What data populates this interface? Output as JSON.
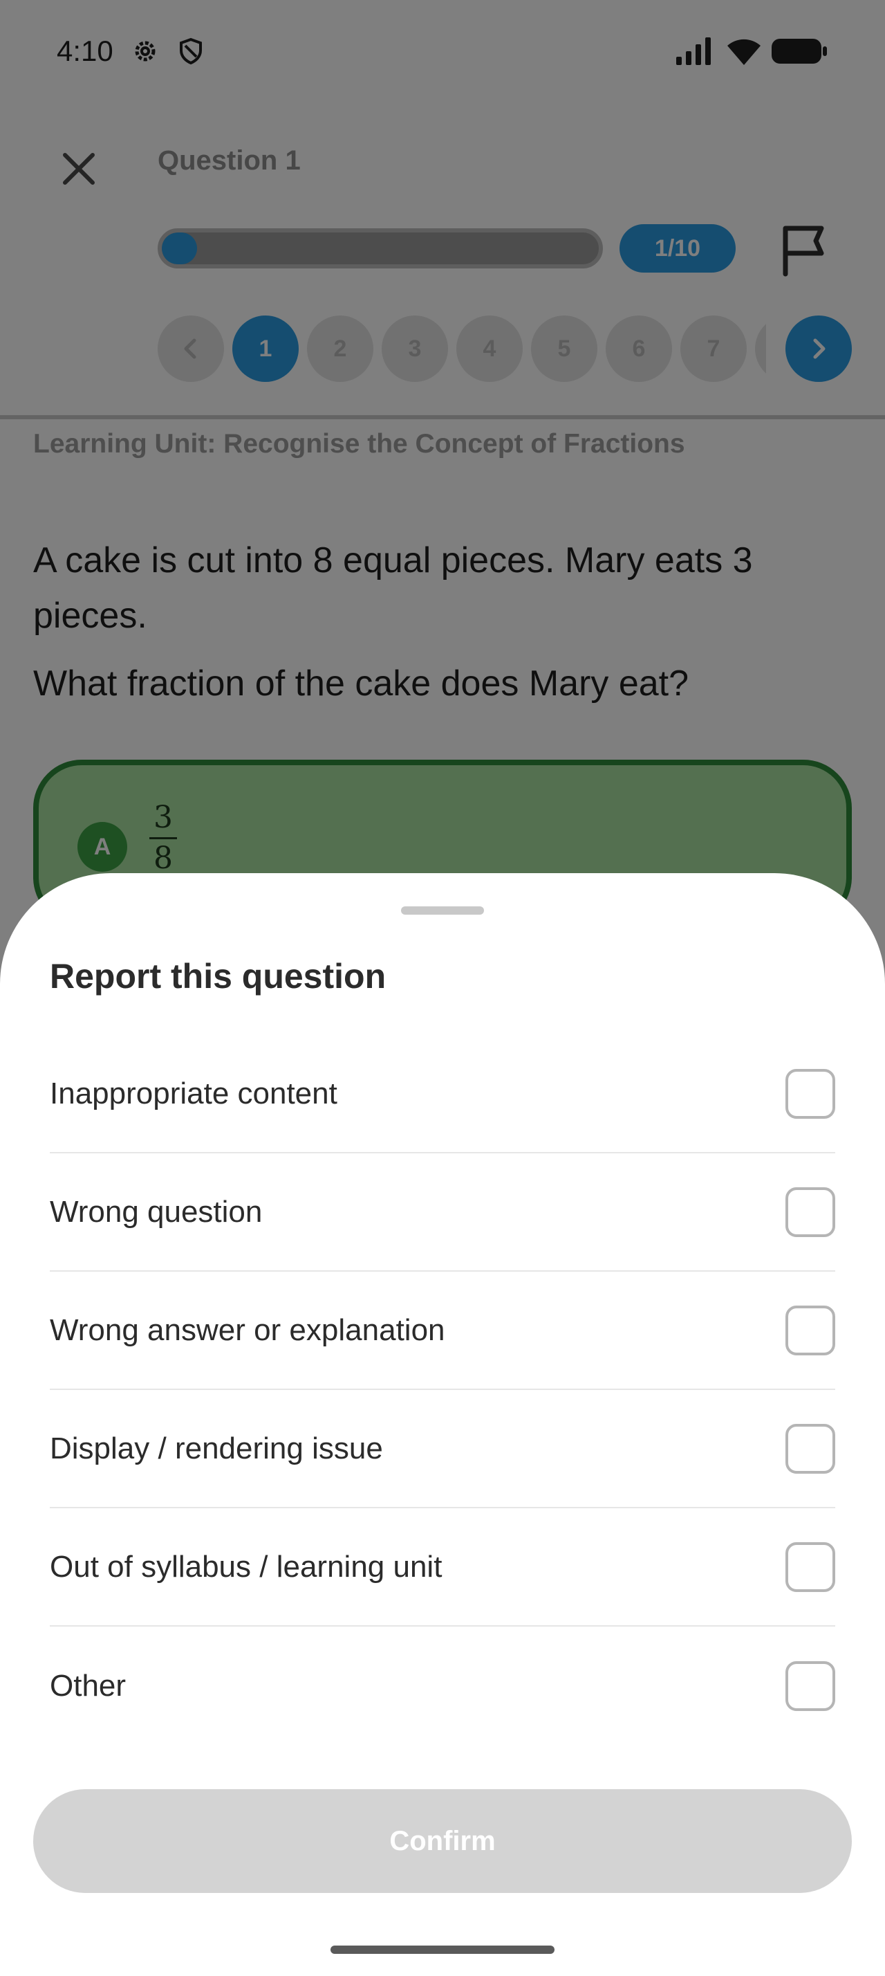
{
  "status_bar": {
    "time": "4:10",
    "icons": [
      "gear-icon",
      "shield-icon",
      "signal-icon",
      "wifi-icon",
      "battery-icon"
    ]
  },
  "header": {
    "title": "Question 1",
    "progress": {
      "label": "1/10",
      "current": 1,
      "total": 10
    },
    "icons": [
      "close-icon",
      "flag-icon"
    ]
  },
  "question_nav": {
    "items": [
      "1",
      "2",
      "3",
      "4",
      "5",
      "6",
      "7"
    ],
    "active": "1",
    "icons": [
      "chevron-left-icon",
      "chevron-right-icon"
    ]
  },
  "question": {
    "learning_unit": "Learning Unit: Recognise the Concept of Fractions",
    "text": "A cake is cut into 8 equal pieces. Mary eats 3 pieces.",
    "prompt": "What fraction of the cake does Mary eat?",
    "option_a": {
      "letter": "A",
      "numerator": "3",
      "denominator": "8"
    }
  },
  "report_sheet": {
    "title": "Report this question",
    "reasons": [
      "Inappropriate content",
      "Wrong question",
      "Wrong answer or explanation",
      "Display / rendering issue",
      "Out of syllabus / learning unit",
      "Other"
    ],
    "confirm_label": "Confirm"
  },
  "colors": {
    "accent": "#2b9be0",
    "correct_bg": "#a8e0a0",
    "correct_border": "#2f8a3a",
    "disabled_button": "#d3d3d3"
  }
}
